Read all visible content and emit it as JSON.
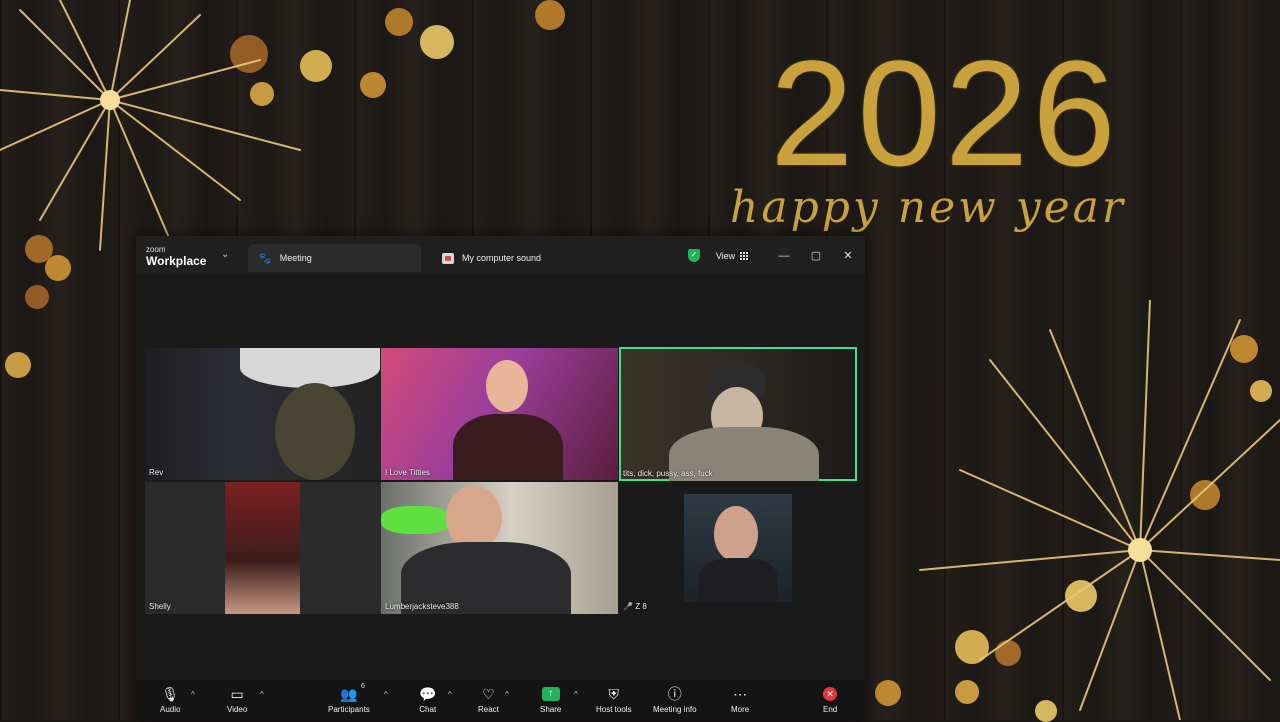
{
  "wallpaper": {
    "year": "2026",
    "greeting": "happy new year"
  },
  "titlebar": {
    "brand_small": "zoom",
    "brand_big": "Workplace",
    "tab_meeting": "Meeting",
    "tab_sound": "My computer sound",
    "view_label": "View"
  },
  "participants": [
    {
      "name": "Rev"
    },
    {
      "name": "I Love Titties"
    },
    {
      "name": "tits, dick, pussy, ass, fuck"
    },
    {
      "name": "Shelly"
    },
    {
      "name": "Lumberjacksteve388"
    },
    {
      "name": "Z 8"
    }
  ],
  "toolbar": {
    "audio": "Audio",
    "video": "Video",
    "participants": "Participants",
    "participants_count": "6",
    "chat": "Chat",
    "react": "React",
    "share": "Share",
    "host_tools": "Host tools",
    "meeting_info": "Meeting info",
    "more": "More",
    "end": "End"
  },
  "colors": {
    "active_speaker": "#3de08b",
    "share_green": "#23b25a",
    "end_red": "#e0383a",
    "gold": "#c9a23e"
  }
}
